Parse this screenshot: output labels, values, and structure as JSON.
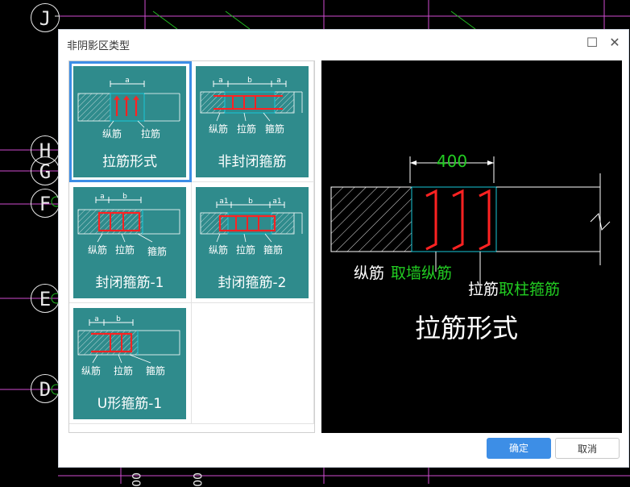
{
  "cad_background": {
    "axis_labels": [
      "J",
      "H",
      "G",
      "F",
      "E",
      "D"
    ],
    "bottom_numbers": [
      "00",
      "00"
    ]
  },
  "dialog": {
    "title": "非阴影区类型",
    "maximize_icon": "☐",
    "close_icon": "✕",
    "ok_label": "确定",
    "cancel_label": "取消"
  },
  "options": [
    {
      "label": "拉筋形式",
      "dim_top": "a",
      "notes": [
        "纵筋",
        "拉筋"
      ],
      "selected": true
    },
    {
      "label": "非封闭箍筋",
      "dim_top": [
        "a",
        "b",
        "a"
      ],
      "notes": [
        "纵筋",
        "拉筋",
        "箍筋"
      ],
      "selected": false
    },
    {
      "label": "封闭箍筋-1",
      "dim_top": [
        "a",
        "b"
      ],
      "notes": [
        "纵筋",
        "拉筋",
        "箍筋"
      ],
      "selected": false
    },
    {
      "label": "封闭箍筋-2",
      "dim_top": [
        "a1",
        "b",
        "a1"
      ],
      "notes": [
        "纵筋",
        "拉筋",
        "箍筋"
      ],
      "selected": false
    },
    {
      "label": "U形箍筋-1",
      "dim_top": [
        "a",
        "b"
      ],
      "notes": [
        "纵筋",
        "拉筋",
        "箍筋"
      ],
      "selected": false
    }
  ],
  "preview": {
    "dimension": "400",
    "label_longitudinal": "纵筋",
    "value_longitudinal": "取墙纵筋",
    "label_tie": "拉筋",
    "value_tie": "取柱箍筋",
    "caption": "拉筋形式"
  },
  "colors": {
    "tile": "#2f8b8c",
    "rebar": "#ff2222",
    "highlight": "#19c7d8",
    "accent_button": "#3d8ee6",
    "preview_green": "#22cc22"
  }
}
